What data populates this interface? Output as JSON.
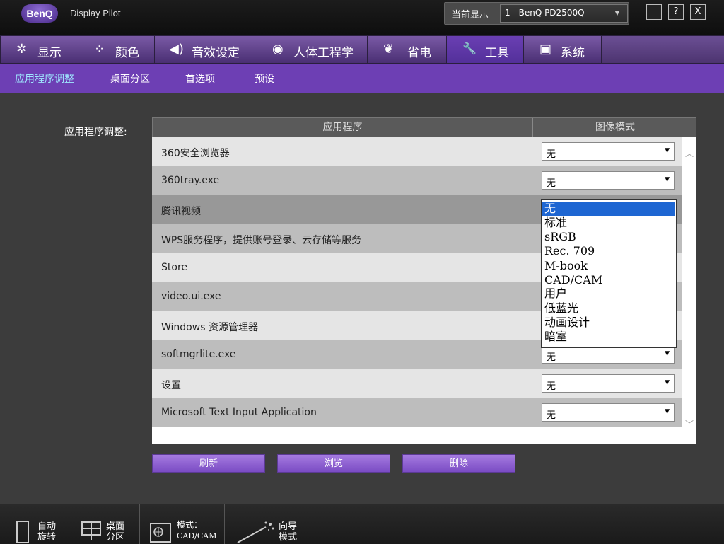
{
  "app": {
    "logo": "BenQ",
    "title": "Display Pilot"
  },
  "monitor": {
    "label": "当前显示",
    "value": "1 - BenQ PD2500Q"
  },
  "window_buttons": {
    "minimize": "_",
    "help": "?",
    "close": "X"
  },
  "tabs": [
    {
      "label": "显示",
      "icon": "display-icon",
      "glyph": "✲"
    },
    {
      "label": "颜色",
      "icon": "color-icon",
      "glyph": "⁘"
    },
    {
      "label": "音效设定",
      "icon": "speaker-icon",
      "glyph": "◀)"
    },
    {
      "label": "人体工程学",
      "icon": "eye-icon",
      "glyph": "◉"
    },
    {
      "label": "省电",
      "icon": "leaf-icon",
      "glyph": "❦"
    },
    {
      "label": "工具",
      "icon": "wrench-icon",
      "glyph": "🔧"
    },
    {
      "label": "系统",
      "icon": "system-icon",
      "glyph": "▣"
    }
  ],
  "active_tab": "工具",
  "subnav": [
    "应用程序调整",
    "桌面分区",
    "首选项",
    "预设"
  ],
  "active_subnav": "应用程序调整",
  "section_label": "应用程序调整:",
  "table": {
    "columns": [
      "应用程序",
      "图像模式"
    ],
    "rows": [
      {
        "name": "360安全浏览器",
        "mode": "无"
      },
      {
        "name": "360tray.exe",
        "mode": "无"
      },
      {
        "name": "腾讯视频",
        "mode": ""
      },
      {
        "name": "WPS服务程序，提供账号登录、云存储等服务",
        "mode": ""
      },
      {
        "name": "Store",
        "mode": ""
      },
      {
        "name": "video.ui.exe",
        "mode": ""
      },
      {
        "name": "Windows 资源管理器",
        "mode": ""
      },
      {
        "name": "softmgrlite.exe",
        "mode": "无"
      },
      {
        "name": "设置",
        "mode": "无"
      },
      {
        "name": "Microsoft Text Input Application",
        "mode": "无"
      }
    ]
  },
  "dropdown_options": [
    "无",
    "标准",
    "sRGB",
    "Rec. 709",
    "M-book",
    "CAD/CAM",
    "用户",
    "低蓝光",
    "动画设计",
    "暗室"
  ],
  "dropdown_selected": "无",
  "buttons": {
    "refresh": "刷新",
    "browse": "浏览",
    "delete": "删除"
  },
  "bottom": [
    {
      "line1": "自动",
      "line2": "旋转",
      "icon": "auto-rotate-icon"
    },
    {
      "line1": "桌面",
      "line2": "分区",
      "icon": "desktop-partition-icon"
    },
    {
      "line1": "模式：",
      "line2": "CAD/CAM",
      "icon": "mode-icon"
    },
    {
      "line1": "向导",
      "line2": "模式",
      "icon": "wizard-icon"
    }
  ],
  "colors": {
    "accent": "#6d3fb4",
    "active_sub": "#9fe8ff",
    "selected": "#1e66d2"
  }
}
